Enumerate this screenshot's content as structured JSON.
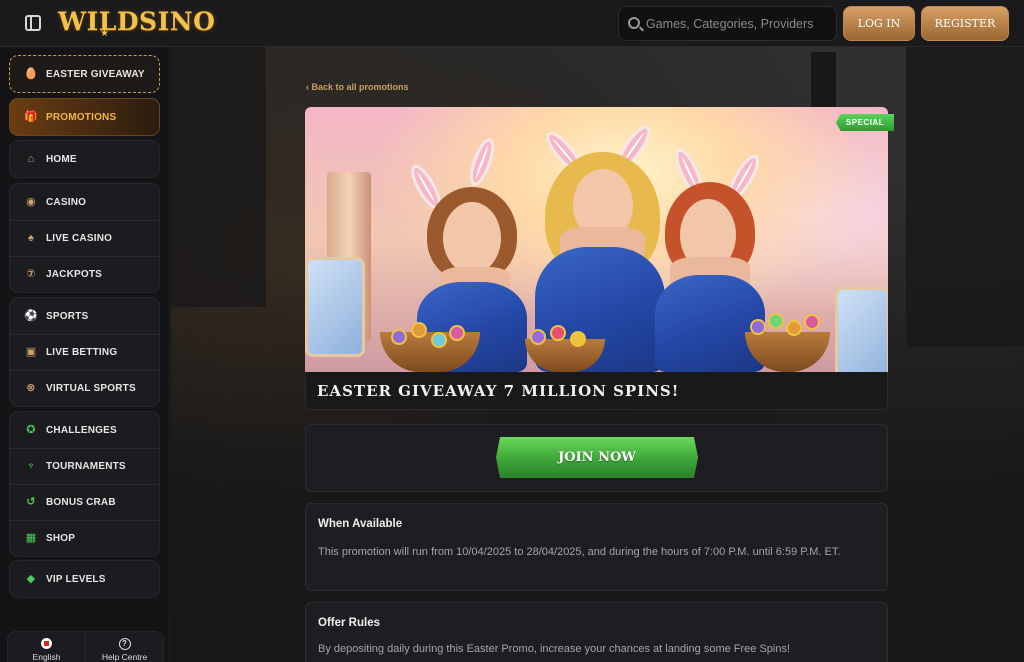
{
  "header": {
    "logo": "WILDSINO",
    "search_placeholder": "Games, Categories, Providers",
    "login_label": "LOG IN",
    "register_label": "REGISTER"
  },
  "sidebar": {
    "easter": "EASTER GIVEAWAY",
    "promotions": "PROMOTIONS",
    "home": "HOME",
    "casino_group": [
      "CASINO",
      "LIVE CASINO",
      "JACKPOTS"
    ],
    "sports_group": [
      "SPORTS",
      "LIVE BETTING",
      "VIRTUAL SPORTS"
    ],
    "challenges_group": [
      "CHALLENGES",
      "TOURNAMENTS",
      "BONUS CRAB",
      "SHOP"
    ],
    "vip": "VIP LEVELS",
    "language": "English",
    "help": "Help Centre"
  },
  "promo": {
    "back_link": "Back to all promotions",
    "badge": "SPECIAL",
    "title": "EASTER GIVEAWAY 7 MILLION SPINS!",
    "join_label": "JOIN NOW",
    "when_heading": "When Available",
    "when_text": "This promotion will run from 10/04/2025 to 28/04/2025, and during the hours of 7:00 P.M. until 6:59 P.M. ET.",
    "rules_heading": "Offer Rules",
    "rules_text": "By depositing daily during this Easter Promo, increase your chances at landing some Free Spins!"
  },
  "colors": {
    "accent_gold": "#f2b54a",
    "join_green": "#3ea63a",
    "special_green": "#2f9a2f"
  }
}
